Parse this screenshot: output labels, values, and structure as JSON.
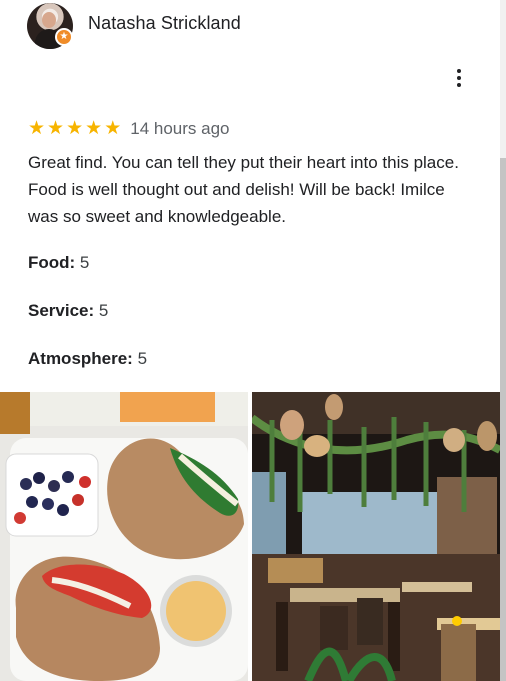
{
  "reviewer": {
    "name": "Natasha Strickland",
    "badge_icon": "local-guide-star-icon"
  },
  "review": {
    "rating": 5,
    "stars": [
      "★",
      "★",
      "★",
      "★",
      "★"
    ],
    "time": "14 hours ago",
    "text": "Great find. You can tell they put their heart into this place. Food is well thought out and delish! Will be back! Imilce was so sweet and knowledgeable.",
    "attributes": {
      "food_label": "Food:",
      "food_value": " 5",
      "service_label": "Service:",
      "service_value": " 5",
      "atmosphere_label": "Atmosphere:",
      "atmosphere_value": " 5"
    }
  },
  "colors": {
    "star": "#f7b400",
    "badge": "#f08c28",
    "muted_text": "#5f6368"
  }
}
